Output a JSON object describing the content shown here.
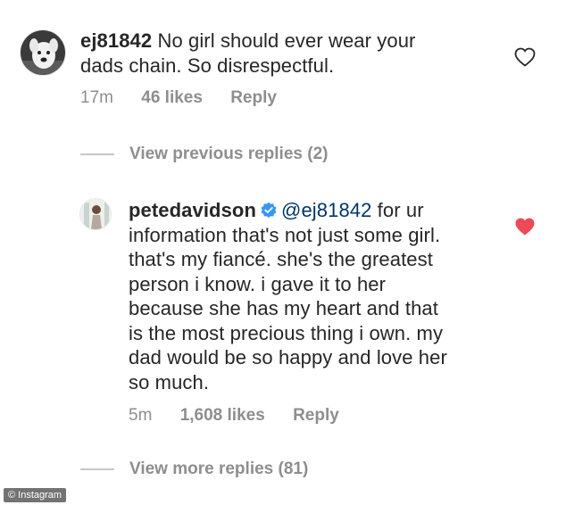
{
  "comment1": {
    "username": "ej81842",
    "text": "No girl should ever wear your dads chain. So disrespectful.",
    "line2": "dads chain. So disrespectful.",
    "line1_text": "No girl should ever wear your",
    "time": "17m",
    "likes": "46 likes",
    "reply": "Reply",
    "liked": false
  },
  "view_previous": "View previous replies (2)",
  "comment2": {
    "username": "petedavidson",
    "verified": true,
    "mention": "@ej81842",
    "lines": [
      "for ur",
      "information that's not just some girl.",
      "that's my fiancé. she's the greatest",
      "person i know. i gave it to her",
      "because she has my heart and that",
      "is the most precious thing i own. my",
      "dad would be so happy and love her",
      "so much."
    ],
    "time": "5m",
    "likes": "1,608 likes",
    "reply": "Reply",
    "liked": true
  },
  "view_more": "View more replies (81)",
  "watermark": "© Instagram",
  "colors": {
    "text": "#262626",
    "meta": "#8e8e8e",
    "heart_liked": "#ed4956",
    "verified": "#3897f0"
  }
}
